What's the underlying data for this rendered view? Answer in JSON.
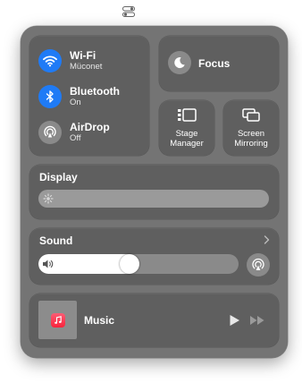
{
  "menubar": {
    "icon": "control-center-icon"
  },
  "connectivity": {
    "wifi": {
      "label": "Wi-Fi",
      "status": "Müconet",
      "icon": "wifi-icon",
      "active": true
    },
    "bluetooth": {
      "label": "Bluetooth",
      "status": "On",
      "icon": "bluetooth-icon",
      "active": true
    },
    "airdrop": {
      "label": "AirDrop",
      "status": "Off",
      "icon": "airdrop-icon",
      "active": false
    }
  },
  "focus": {
    "label": "Focus",
    "icon": "moon-icon"
  },
  "stage_manager": {
    "label_line1": "Stage",
    "label_line2": "Manager",
    "icon": "stage-manager-icon"
  },
  "screen_mirroring": {
    "label_line1": "Screen",
    "label_line2": "Mirroring",
    "icon": "screen-mirroring-icon"
  },
  "display": {
    "title": "Display",
    "brightness": 0.0,
    "icon": "sun-icon"
  },
  "sound": {
    "title": "Sound",
    "volume": 0.45,
    "icon": "speaker-icon",
    "output_icon": "airplay-audio-icon"
  },
  "music": {
    "label": "Music",
    "app_icon": "music-note-icon"
  },
  "colors": {
    "accent_blue": "#1f7bf6",
    "panel_bg": "#747474",
    "tile_bg": "#5f5f5f",
    "music_red": "#fa233b"
  }
}
